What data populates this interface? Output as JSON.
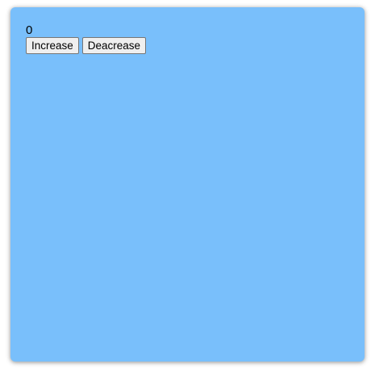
{
  "counter": {
    "value": "0"
  },
  "buttons": {
    "increase_label": "Increase",
    "decrease_label": "Deacrease"
  },
  "colors": {
    "panel_background": "#79bffb",
    "button_background": "#efefef"
  }
}
